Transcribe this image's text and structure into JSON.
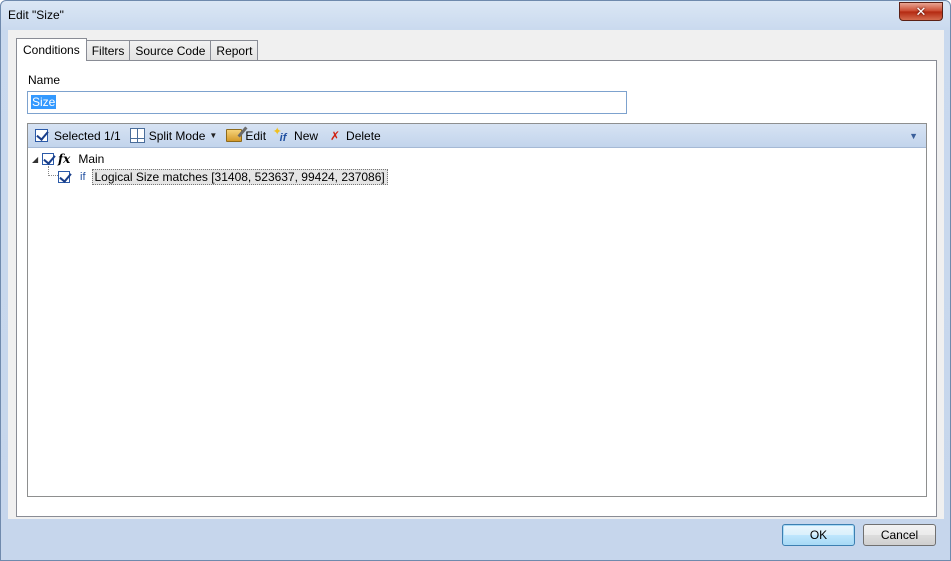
{
  "window": {
    "title": "Edit \"Size\"",
    "close_label": "✕"
  },
  "tabs": [
    {
      "label": "Conditions",
      "active": true
    },
    {
      "label": "Filters",
      "active": false
    },
    {
      "label": "Source Code",
      "active": false
    },
    {
      "label": "Report",
      "active": false
    }
  ],
  "name_field": {
    "label": "Name",
    "value": "Size"
  },
  "toolbar": {
    "selected_label": "Selected 1/1",
    "split_mode_label": "Split Mode",
    "edit_label": "Edit",
    "new_label": "New",
    "new_icon_text": "if",
    "delete_label": "Delete"
  },
  "tree": {
    "root": {
      "label": "Main",
      "icon_text": "fx",
      "checked": true
    },
    "children": [
      {
        "keyword": "if",
        "label": "Logical Size matches [31408, 523637, 99424, 237086]",
        "checked": true
      }
    ]
  },
  "buttons": {
    "ok_label": "OK",
    "cancel_label": "Cancel"
  },
  "colors": {
    "accent": "#3399ff",
    "toolbar": "#c9d9ee",
    "keyword": "#1f4fa0"
  }
}
